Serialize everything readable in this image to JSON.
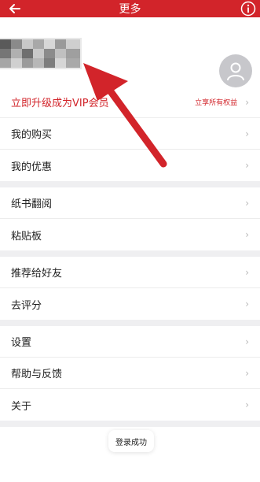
{
  "header": {
    "title": "更多",
    "back_icon": "arrow-left-icon",
    "info_icon": "info-icon"
  },
  "vip": {
    "label": "立即升级成为VIP会员",
    "sub": "立享所有权益"
  },
  "menu": {
    "purchases": "我的购买",
    "discounts": "我的优惠",
    "paper_reading": "纸书翻阅",
    "clipboard": "粘贴板",
    "recommend": "推荐给好友",
    "rate": "去评分",
    "settings": "设置",
    "help": "帮助与反馈",
    "about": "关于"
  },
  "toast": {
    "text": "登录成功"
  },
  "colors": {
    "accent": "#d2242a",
    "background": "#efeff1"
  }
}
